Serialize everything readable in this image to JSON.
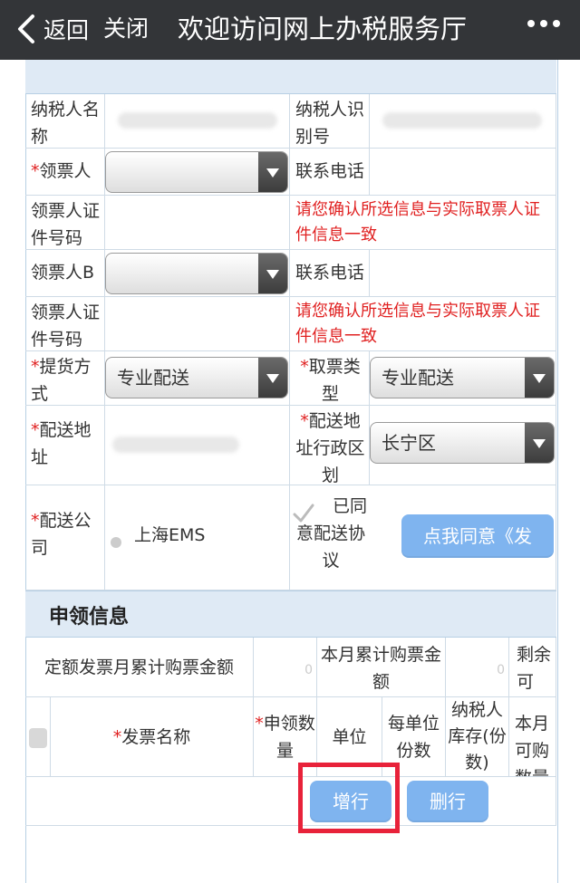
{
  "topbar": {
    "back_label": "返回",
    "close_label": "关闭",
    "title": "欢迎访问网上办税服务厅"
  },
  "form": {
    "taxpayer_name_label": "纳税人名称",
    "taxpayer_id_label": "纳税人识别号",
    "required_mark": "*",
    "collector_label": "领票人",
    "collector_select_value": "",
    "phone_label": "联系电话",
    "collector_id_label": "领票人证件号码",
    "confirm_notice": "请您确认所选信息与实际取票人证件信息一致",
    "collector_b_label": "领票人B",
    "collector_b_select_value": "",
    "phone_b_label": "联系电话",
    "collector_b_id_label": "领票人证件号码",
    "confirm_notice_b": "请您确认所选信息与实际取票人证件信息一致",
    "delivery_method_label": "提货方式",
    "delivery_method_value": "专业配送",
    "ticket_type_label": "取票类型",
    "ticket_type_value": "专业配送",
    "address_label": "配送地址",
    "district_label": "配送地址行政区划",
    "district_value": "长宁区",
    "courier_label": "配送公司",
    "courier_option": "上海EMS",
    "agreed_label": "已同意配送协议",
    "agree_button": "点我同意《发"
  },
  "apply": {
    "section_title": "申领信息",
    "quota_label": "定额发票月累计购票金额",
    "quota_value": "0",
    "month_total_label": "本月累计购票金额",
    "month_total_value": "0",
    "remain_label": "剩余可",
    "table_headers": {
      "invoice_name": "发票名称",
      "apply_qty": "申领数量",
      "unit": "单位",
      "per_unit": "每单位份数",
      "stock": "纳税人库存(份数)",
      "month_qty": "本月可购数量"
    },
    "add_row_button": "增行",
    "delete_row_button": "删行"
  }
}
